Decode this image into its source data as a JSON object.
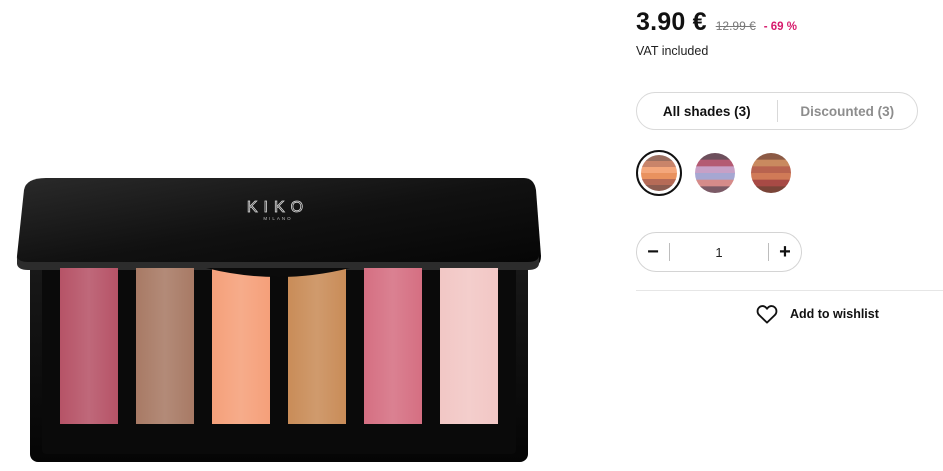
{
  "product": {
    "brand_logo": "KIKO",
    "brand_sub": "MILANO",
    "image_name": "eyeshadow-palette",
    "pan_colors": [
      "#b65367",
      "#a87a65",
      "#f5a07a",
      "#c98c58",
      "#d56f82",
      "#f2c7c5"
    ]
  },
  "price": {
    "current": "3.90 €",
    "old": "12.99 €",
    "discount": "- 69 %",
    "vat": "VAT included",
    "discount_color": "#d6196b"
  },
  "tabs": [
    {
      "label": "All shades (3)",
      "active": true
    },
    {
      "label": "Discounted (3)",
      "active": false
    }
  ],
  "swatches": [
    {
      "name": "shade-1",
      "selected": true,
      "colors": [
        "#9a6e5f",
        "#c9846a",
        "#f4a77c",
        "#e9925f",
        "#b66b57",
        "#8c5c50"
      ]
    },
    {
      "name": "shade-2",
      "selected": false,
      "colors": [
        "#6d4f5c",
        "#b45a72",
        "#c7a0c6",
        "#a6a7d2",
        "#d58b8a",
        "#7b5a66"
      ]
    },
    {
      "name": "shade-3",
      "selected": false,
      "colors": [
        "#8c5a45",
        "#c98a5f",
        "#b8634f",
        "#d07a57",
        "#a84a45",
        "#7a4438"
      ]
    }
  ],
  "quantity": {
    "minus": "−",
    "value": "1",
    "plus": "+"
  },
  "wishlist": {
    "icon": "heart-icon",
    "label": "Add to wishlist"
  }
}
